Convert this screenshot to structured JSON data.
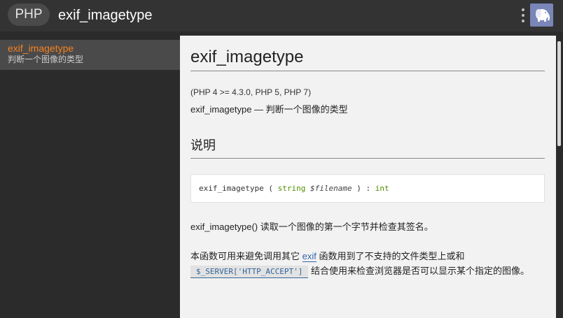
{
  "header": {
    "lang_badge": "PHP",
    "title": "exif_imagetype",
    "menu_icon": "kebab-menu-icon",
    "app_icon": "elephant-icon",
    "app_icon_color": "#7a86b8"
  },
  "sidebar": {
    "items": [
      {
        "name": "exif_imagetype",
        "desc": "判断一个图像的类型"
      }
    ],
    "accent": "#f58220"
  },
  "content": {
    "refname": "exif_imagetype",
    "version": "(PHP 4 >= 4.3.0, PHP 5, PHP 7)",
    "refpurpose": "exif_imagetype — 判断一个图像的类型",
    "section_title": "说明",
    "synopsis": {
      "func": "exif_imagetype",
      "open": " ( ",
      "param_type": "string",
      "param_name": " $filename",
      "close": " ) : ",
      "return_type": "int"
    },
    "para1": "exif_imagetype() 读取一个图像的第一个字节并检查其签名。",
    "para2": {
      "pre": "本函数可用来避免调用其它 ",
      "link": "exif",
      "mid": " 函数用到了不支持的文件类型上或和",
      "code": "$_SERVER['HTTP_ACCEPT']",
      "post": " 结合使用来检查浏览器是否可以显示某个指定的图像。"
    }
  }
}
